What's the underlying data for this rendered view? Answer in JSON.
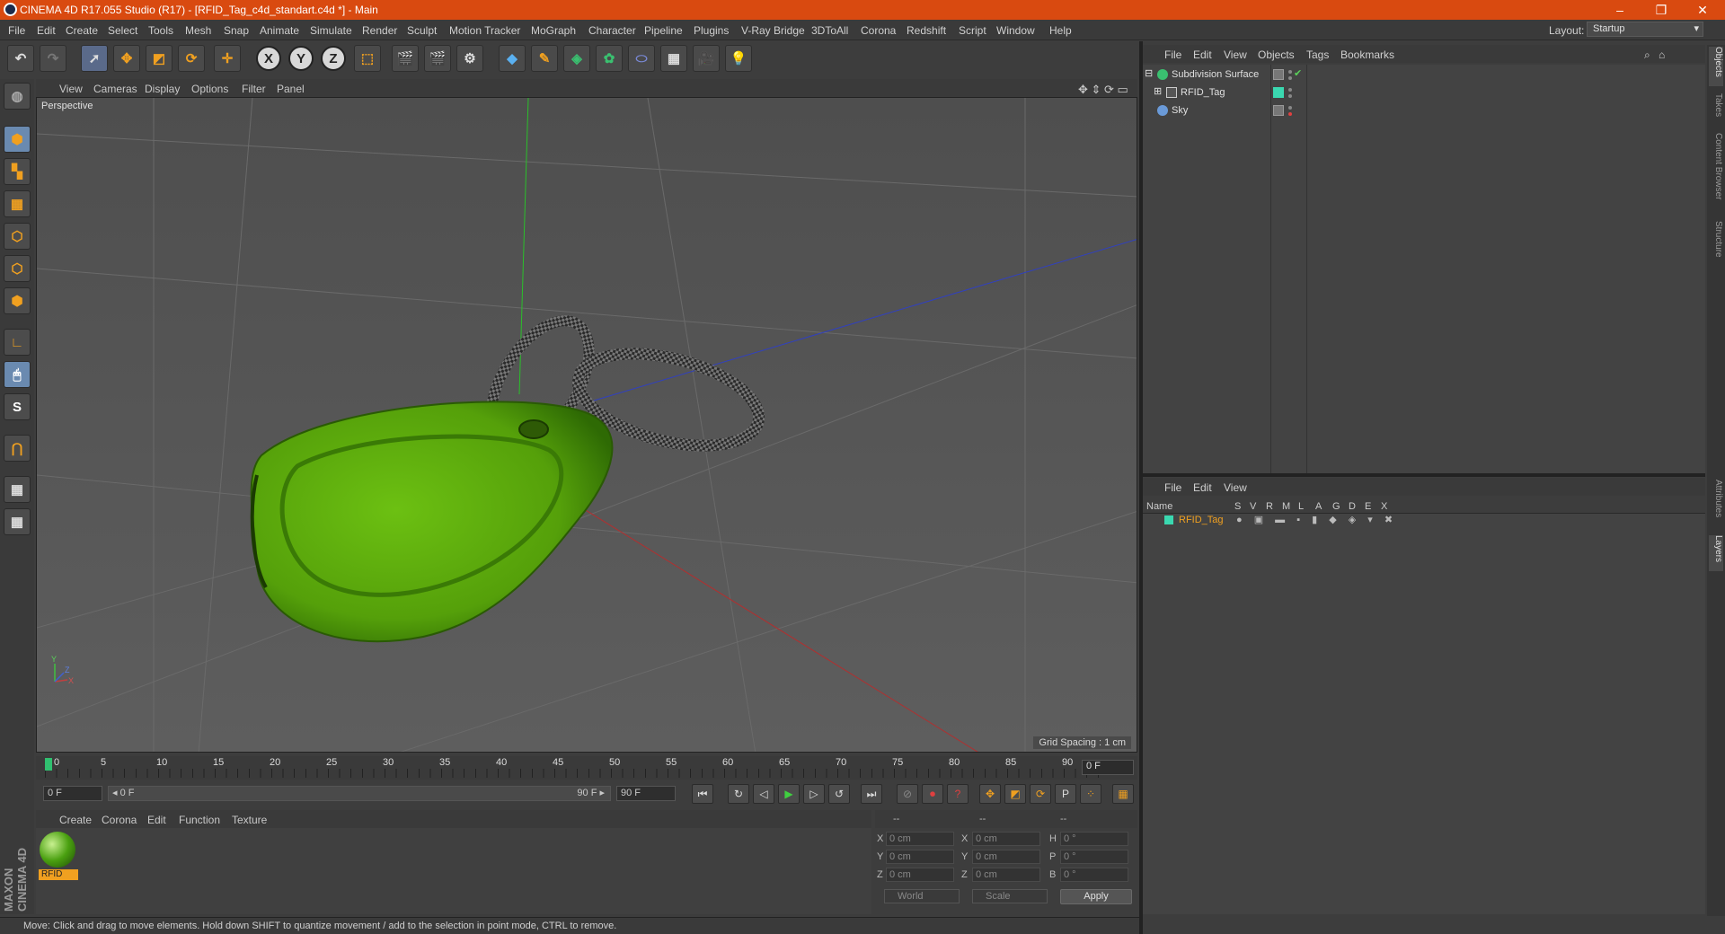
{
  "window": {
    "title": "CINEMA 4D R17.055 Studio (R17) - [RFID_Tag_c4d_standart.c4d *] - Main",
    "controls": [
      "–",
      "❐",
      "✕"
    ]
  },
  "menubar": {
    "items": [
      "File",
      "Edit",
      "Create",
      "Select",
      "Tools",
      "Mesh",
      "Snap",
      "Animate",
      "Simulate",
      "Render",
      "Sculpt",
      "Motion Tracker",
      "MoGraph",
      "Character",
      "Pipeline",
      "Plugins",
      "V-Ray Bridge",
      "3DToAll",
      "Corona",
      "Redshift",
      "Script",
      "Window",
      "Help"
    ],
    "layout_label": "Layout:",
    "layout_value": "Startup"
  },
  "toolbar": {
    "axis_x": "X",
    "axis_y": "Y",
    "axis_z": "Z"
  },
  "viewport": {
    "menu": [
      "View",
      "Cameras",
      "Display",
      "Options",
      "Filter",
      "Panel"
    ],
    "camera_label": "Perspective",
    "grid_spacing": "Grid Spacing : 1 cm",
    "axis_y_label": "Y",
    "axis_x_label": "X",
    "axis_z_label": "Z"
  },
  "timeline": {
    "ticks": [
      "0",
      "5",
      "10",
      "15",
      "20",
      "25",
      "30",
      "35",
      "40",
      "45",
      "50",
      "55",
      "60",
      "65",
      "70",
      "75",
      "80",
      "85",
      "90"
    ],
    "current_frame": "0 F"
  },
  "transport": {
    "start_frame": "0 F",
    "range_start": "◂ 0 F",
    "range_end": "90 F ▸",
    "end_frame": "90 F"
  },
  "material_manager": {
    "menu": [
      "Create",
      "Corona",
      "Edit",
      "Function",
      "Texture"
    ],
    "materials": [
      {
        "name": "RFID",
        "color": "#4aa010"
      }
    ]
  },
  "coordinates": {
    "headers": [
      "--",
      "--",
      "--"
    ],
    "rows": [
      {
        "axis": "X",
        "pos": "0 cm",
        "axis2": "X",
        "size": "0 cm",
        "rot_label": "H",
        "rot": "0 °"
      },
      {
        "axis": "Y",
        "pos": "0 cm",
        "axis2": "Y",
        "size": "0 cm",
        "rot_label": "P",
        "rot": "0 °"
      },
      {
        "axis": "Z",
        "pos": "0 cm",
        "axis2": "Z",
        "size": "0 cm",
        "rot_label": "B",
        "rot": "0 °"
      }
    ],
    "space_select": "World",
    "mode_select": "Scale",
    "apply_label": "Apply"
  },
  "status_bar": {
    "message": "Move: Click and drag to move elements. Hold down SHIFT to quantize movement / add to the selection in point mode, CTRL to remove."
  },
  "object_manager": {
    "menu": [
      "File",
      "Edit",
      "View",
      "Objects",
      "Tags",
      "Bookmarks"
    ],
    "objects": [
      {
        "name": "Subdivision Surface",
        "icon_color": "#3ac070"
      },
      {
        "name": "RFID_Tag",
        "icon_color": "#c8c8c8"
      },
      {
        "name": "Sky",
        "icon_color": "#6a9ad8"
      }
    ]
  },
  "layer_manager": {
    "menu": [
      "File",
      "Edit",
      "View"
    ],
    "columns": [
      "Name",
      "S",
      "V",
      "R",
      "M",
      "L",
      "A",
      "G",
      "D",
      "E",
      "X"
    ],
    "layers": [
      {
        "name": "RFID_Tag",
        "color": "#3ad8b0"
      }
    ]
  },
  "right_tabs": [
    "Objects",
    "Takes",
    "Content Browser",
    "Structure",
    "Attributes",
    "Layers"
  ],
  "branding": "MAXON CINEMA 4D",
  "colors": {
    "accent_orange": "#f0a020",
    "title_bar": "#d94a10",
    "tag_green": "#4aa010"
  }
}
